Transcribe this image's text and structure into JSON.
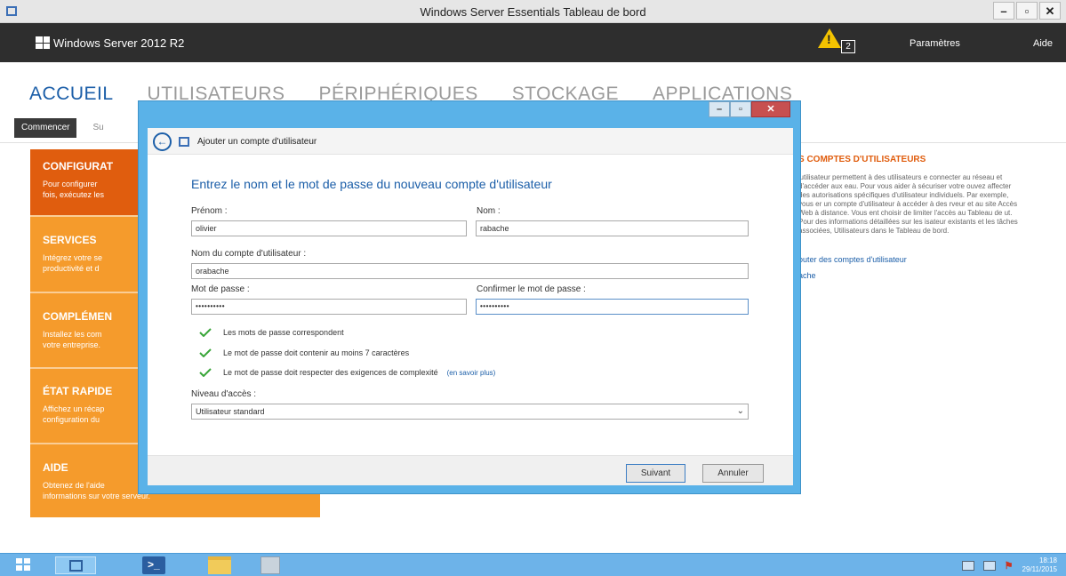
{
  "window": {
    "title": "Windows Server Essentials Tableau de bord",
    "min_label": "–",
    "restore_label": "▫",
    "close_label": "✕"
  },
  "header": {
    "product": "Windows Server 2012 R2",
    "alert_count": "2",
    "settings_label": "Paramètres",
    "help_label": "Aide"
  },
  "nav": {
    "tabs": [
      "ACCUEIL",
      "UTILISATEURS",
      "PÉRIPHÉRIQUES",
      "STOCKAGE",
      "APPLICATIONS"
    ]
  },
  "subtabs": {
    "start": "Commencer",
    "other": "Su"
  },
  "left_panel": {
    "sections": [
      {
        "title": "CONFIGURAT",
        "text": "Pour configurer\nfois, exécutez les"
      },
      {
        "title": "SERVICES",
        "text": "Intégrez votre se\nproductivité et d"
      },
      {
        "title": "COMPLÉMEN",
        "text": "Installez les com\nvotre entreprise."
      },
      {
        "title": "ÉTAT RAPIDE",
        "text": "Affichez un récap\nconfiguration du"
      },
      {
        "title": "AIDE",
        "text": "Obtenez de l'aide\ninformations sur votre serveur."
      }
    ]
  },
  "right_panel": {
    "title": "S COMPTES D'UTILISATEURS",
    "text": "'utilisateur permettent à des utilisateurs e connecter au réseau et d'accéder aux eau. Pour vous aider à sécuriser votre ouvez affecter des autorisations spécifiques d'utilisateur individuels. Par exemple, vous er un compte d'utilisateur à accéder à des rveur et au site Accès Web à distance. Vous ent choisir de limiter l'accès au Tableau de ut. Pour des informations détaillées sur les isateur existants et les tâches associées, Utilisateurs dans le Tableau de bord.",
    "link1": "outer des comptes d'utilisateur",
    "link2": "ache"
  },
  "dialog": {
    "title": "Ajouter un compte d'utilisateur",
    "back_label": "←",
    "heading": "Entrez le nom et le mot de passe du nouveau compte d'utilisateur",
    "first_name_label": "Prénom :",
    "first_name_value": "olivier",
    "last_name_label": "Nom :",
    "last_name_value": "rabache",
    "account_label": "Nom du compte d'utilisateur :",
    "account_value": "orabache",
    "password_label": "Mot de passe :",
    "password_value": "••••••••••",
    "confirm_label": "Confirmer le mot de passe :",
    "confirm_value": "••••••••••",
    "checks": [
      "Les mots de passe correspondent",
      "Le mot de passe doit contenir au moins 7 caractères",
      "Le mot de passe doit respecter des exigences de complexité"
    ],
    "learn_more": "(en savoir plus)",
    "access_label": "Niveau d'accès :",
    "access_value": "Utilisateur standard",
    "next_label": "Suivant",
    "cancel_label": "Annuler"
  },
  "taskbar": {
    "ps_glyph": ">_",
    "time": "18:18",
    "date": "29/11/2015"
  },
  "colors": {
    "accent": "#1b5ea8",
    "orange": "#f59b2c",
    "orange_dark": "#e05d0e",
    "dialog_frame": "#5ab2e8",
    "taskbar": "#6db3e9",
    "check": "#3aa63a"
  }
}
